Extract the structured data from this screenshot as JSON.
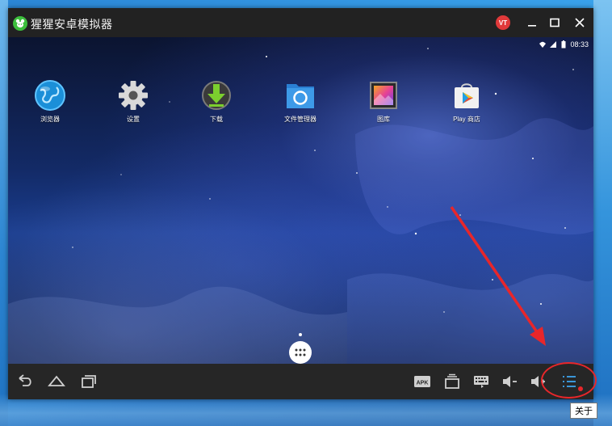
{
  "window": {
    "title": "猩猩安卓模拟器",
    "avatar_text": "VT",
    "accent": "#e0393a",
    "logo_color": "#3cbf3c"
  },
  "statusbar": {
    "time": "08:33",
    "icons": [
      "wifi-icon",
      "signal-icon",
      "battery-icon"
    ]
  },
  "home_apps": [
    {
      "label": "浏览器",
      "icon": "browser-globe-icon"
    },
    {
      "label": "设置",
      "icon": "settings-gear-icon"
    },
    {
      "label": "下载",
      "icon": "download-arrow-icon"
    },
    {
      "label": "文件管理器",
      "icon": "file-manager-icon"
    },
    {
      "label": "图库",
      "icon": "gallery-icon"
    },
    {
      "label": "Play 商店",
      "icon": "play-store-icon"
    }
  ],
  "navbar": {
    "left": [
      "back-icon",
      "home-icon",
      "recent-apps-icon"
    ],
    "right": [
      "apk-install-icon",
      "multi-window-icon",
      "keyboard-icon",
      "volume-down-icon",
      "volume-up-icon",
      "menu-list-icon"
    ],
    "apk_label": "APK"
  },
  "tooltip": {
    "text": "关于"
  },
  "annotation": {
    "color": "#e8262a"
  }
}
